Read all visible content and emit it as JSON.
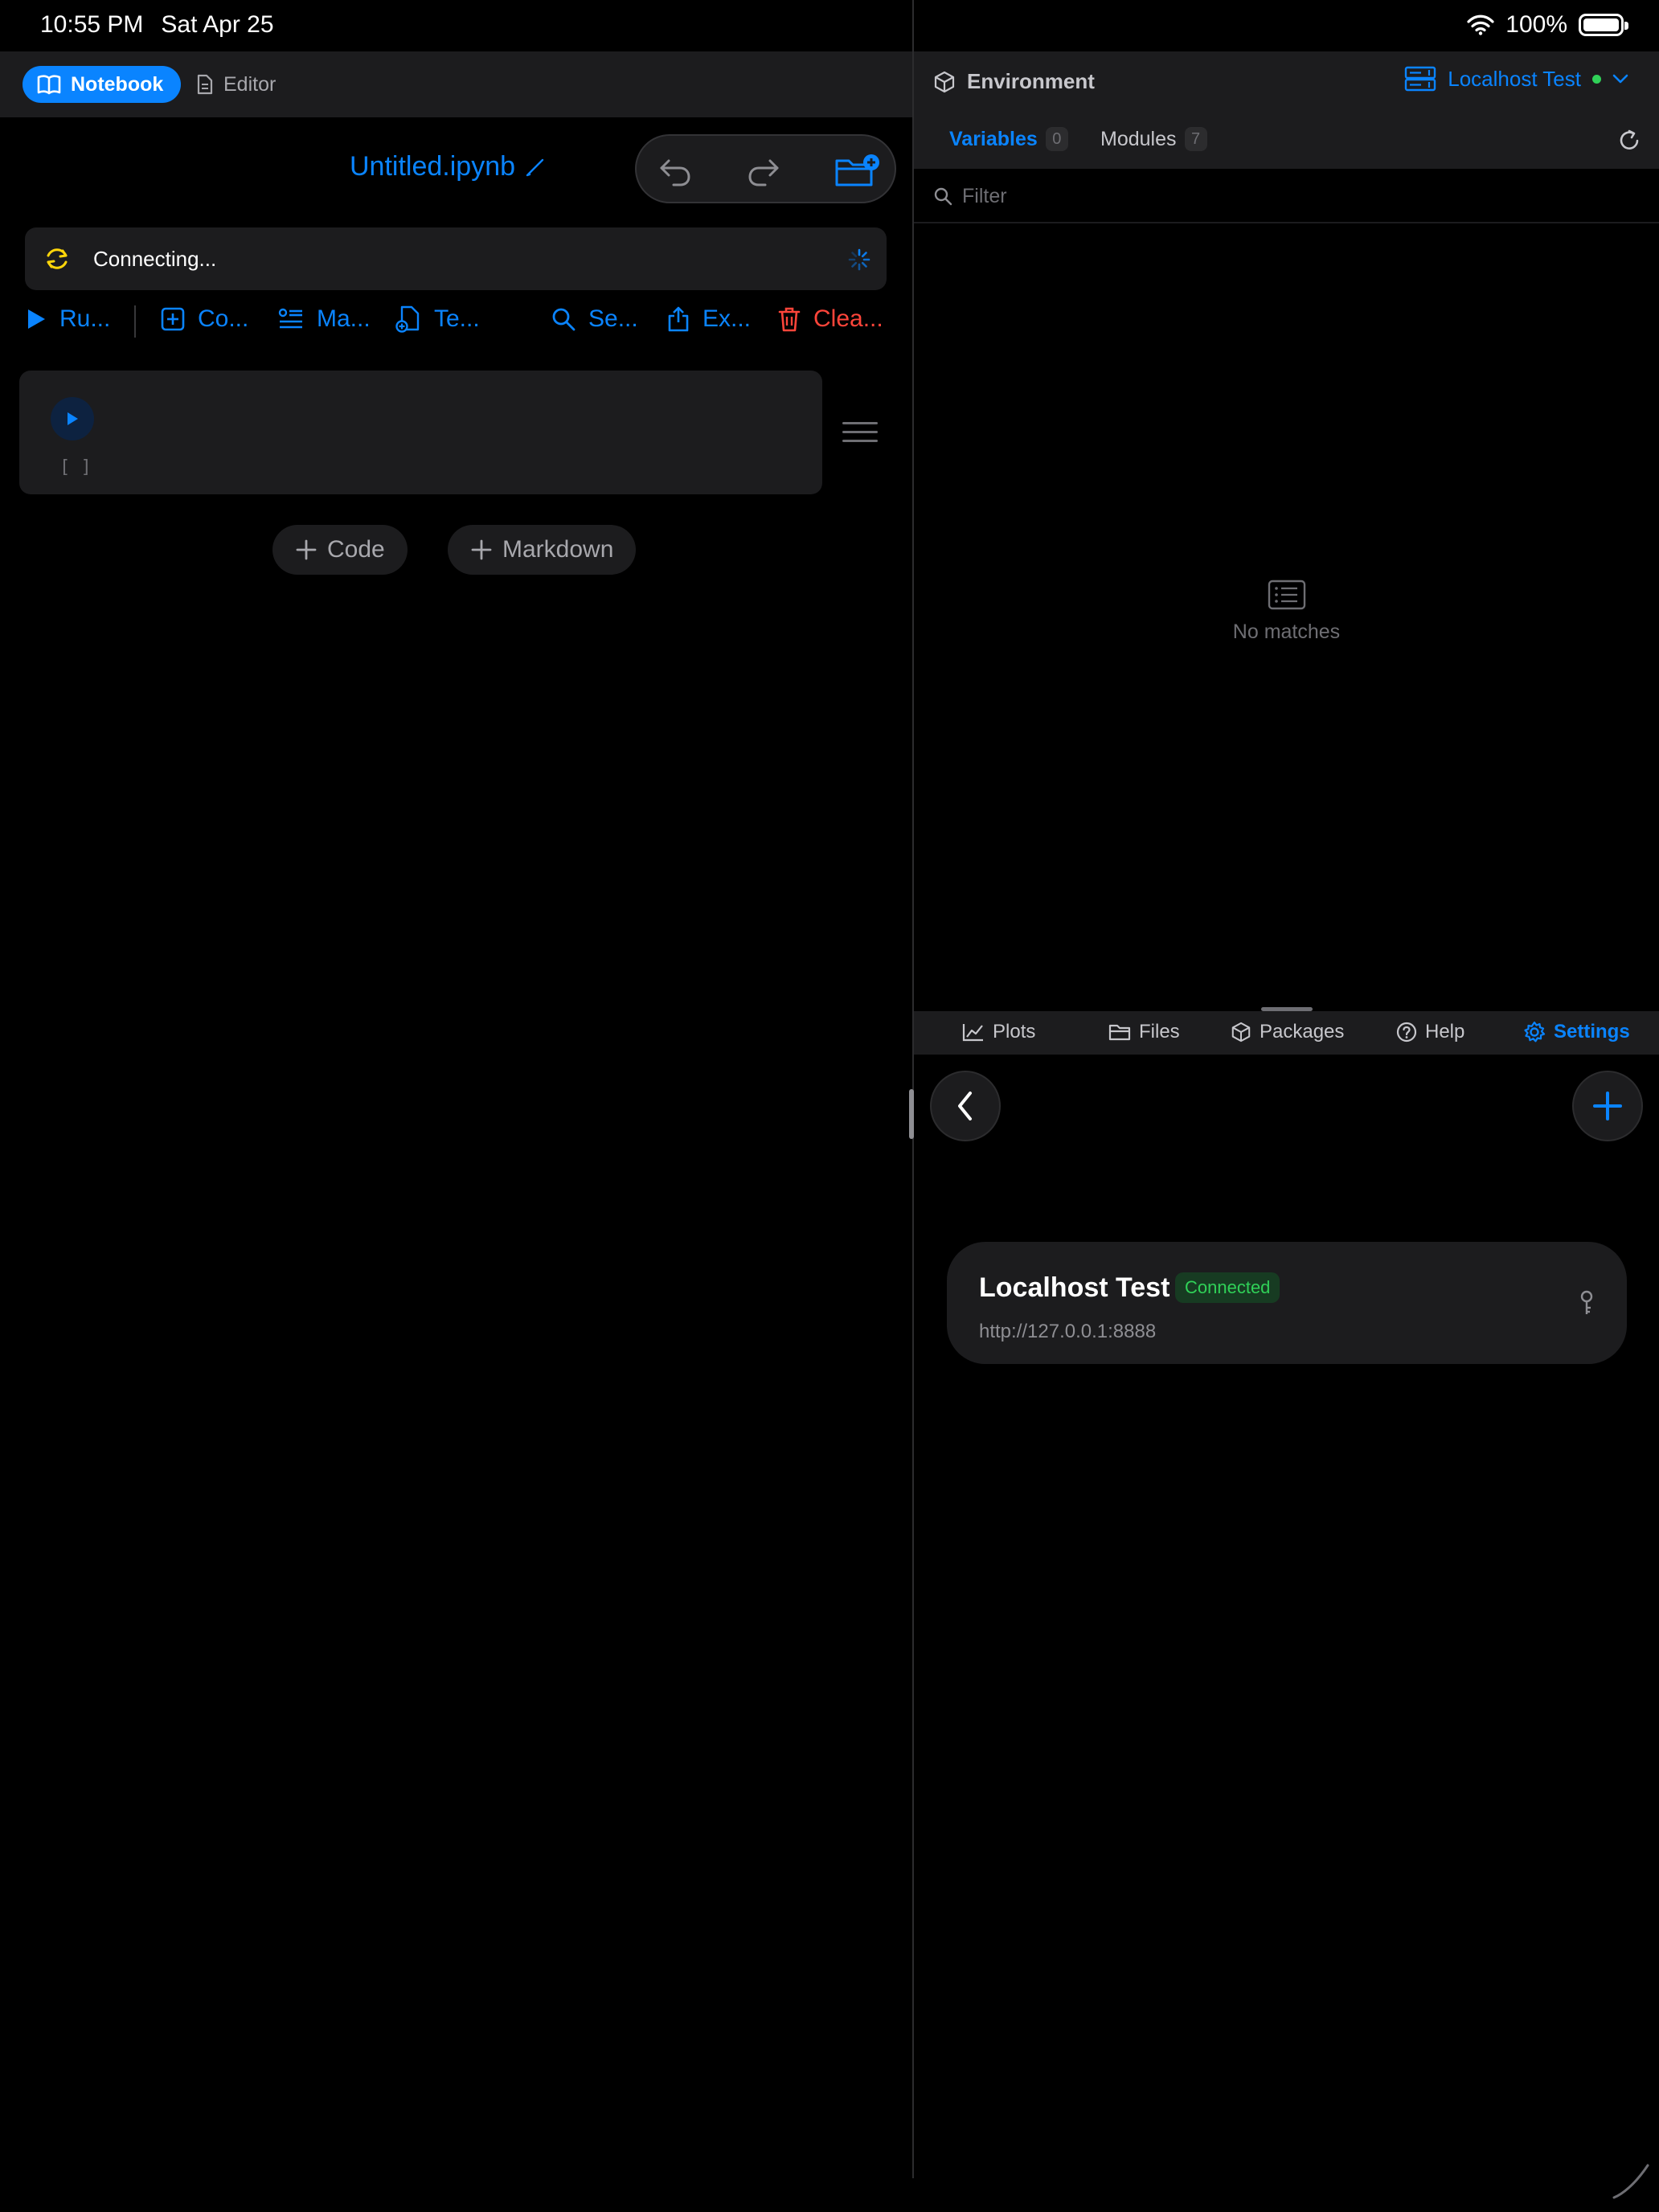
{
  "status_bar": {
    "time": "10:55 PM",
    "date": "Sat Apr 25",
    "battery": "100%"
  },
  "left_header": {
    "notebook_label": "Notebook",
    "editor_label": "Editor"
  },
  "notebook": {
    "title": "Untitled.ipynb",
    "connection_status": "Connecting...",
    "actions": {
      "run": "Ru...",
      "code": "Co...",
      "markdown": "Ma...",
      "template": "Te...",
      "search": "Se...",
      "export": "Ex...",
      "clear": "Clea..."
    },
    "cell": {
      "execution_count": "[ ]"
    },
    "add_code_label": "Code",
    "add_markdown_label": "Markdown"
  },
  "environment": {
    "title": "Environment",
    "host_name": "Localhost Test",
    "tabs": {
      "variables_label": "Variables",
      "variables_count": "0",
      "modules_label": "Modules",
      "modules_count": "7"
    },
    "filter_placeholder": "Filter",
    "empty_text": "No matches"
  },
  "bottom_tabs": {
    "plots": "Plots",
    "files": "Files",
    "packages": "Packages",
    "help": "Help",
    "settings": "Settings"
  },
  "server": {
    "name": "Localhost Test",
    "status": "Connected",
    "url": "http://127.0.0.1:8888"
  },
  "colors": {
    "accent": "#0a84ff",
    "danger": "#ff453a",
    "success": "#30d158",
    "warning": "#ffd60a",
    "panel": "#1c1c1e",
    "background": "#000000"
  }
}
